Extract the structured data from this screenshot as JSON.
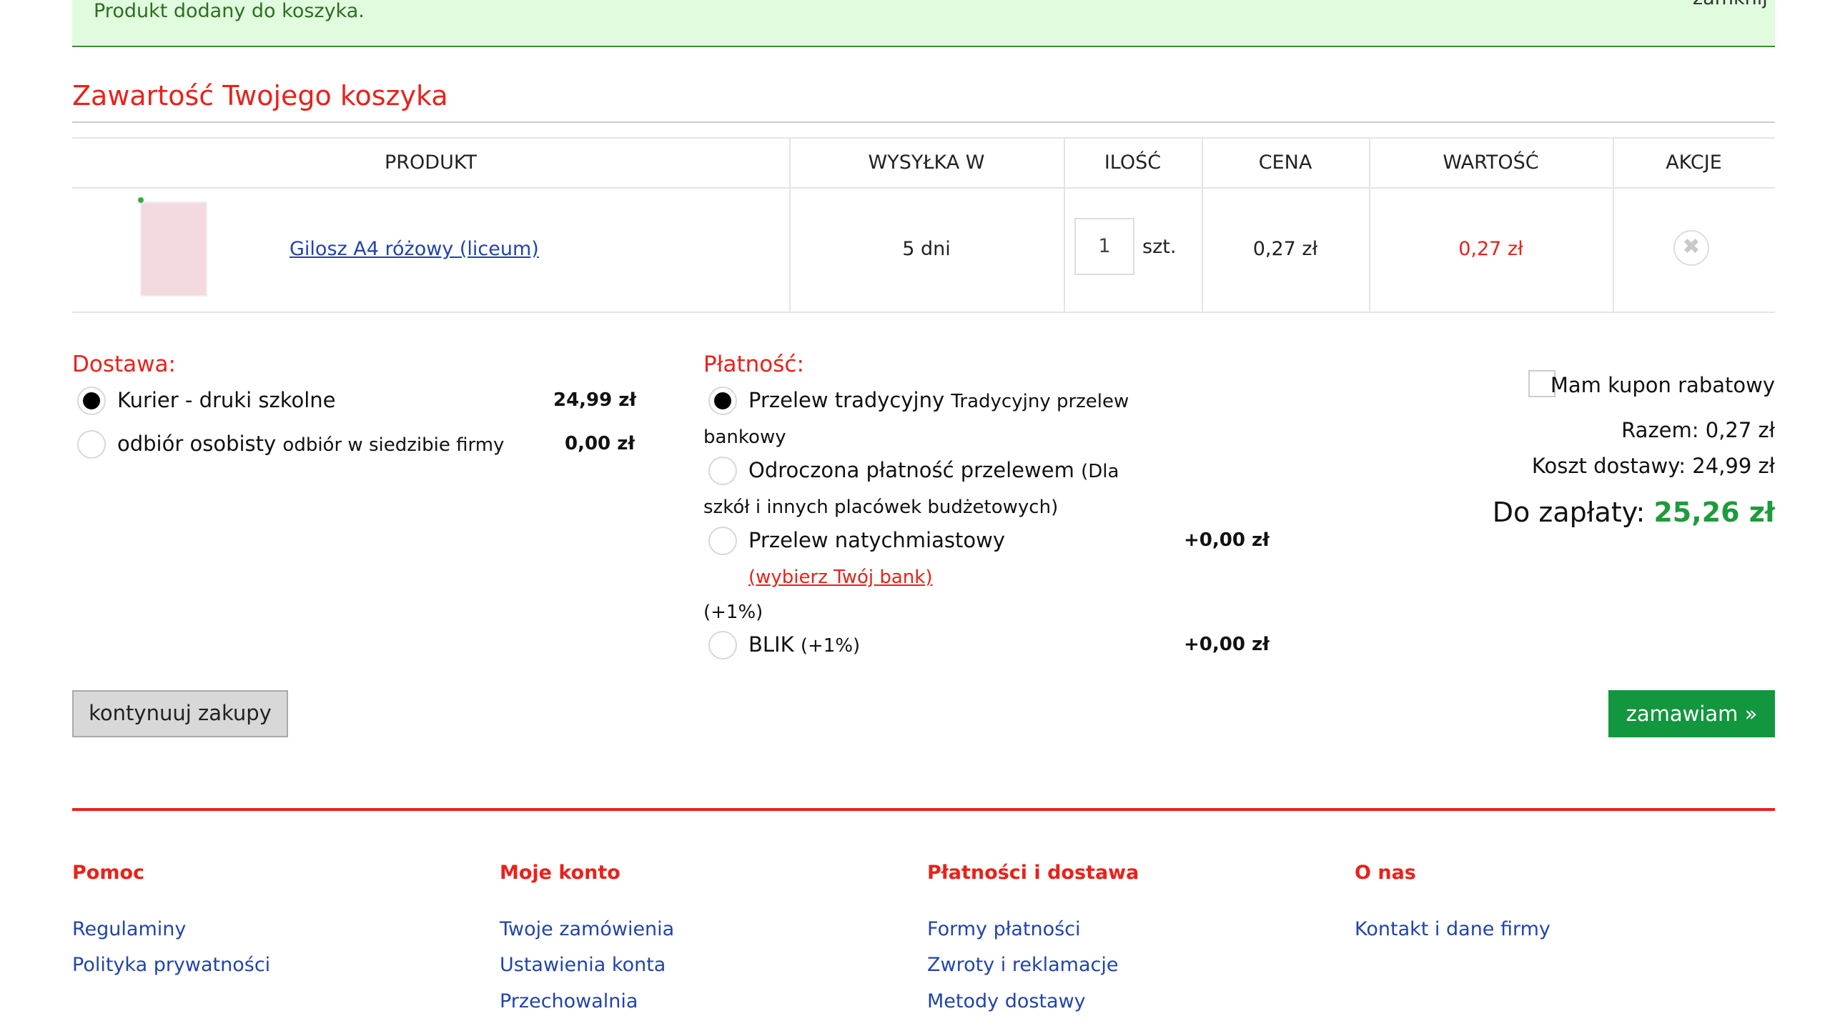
{
  "notice": {
    "text": "Produkt dodany do koszyka.",
    "close": "zamknij"
  },
  "cart": {
    "title": "Zawartość Twojego koszyka",
    "columns": [
      "PRODUKT",
      "WYSYŁKA W",
      "ILOŚĆ",
      "CENA",
      "WARTOŚĆ",
      "AKCJE"
    ],
    "items": [
      {
        "name": "Gilosz A4 różowy (liceum)",
        "shipping": "5 dni",
        "qty": "1",
        "unit": "szt.",
        "price": "0,27 zł",
        "value": "0,27 zł"
      }
    ]
  },
  "delivery": {
    "title": "Dostawa:",
    "options": [
      {
        "label": "Kurier - druki szkolne",
        "sub": "",
        "price": "24,99 zł",
        "selected": true
      },
      {
        "label": "odbiór osobisty",
        "sub": "odbiór w siedzibie firmy",
        "price": "0,00 zł",
        "selected": false
      }
    ]
  },
  "payment": {
    "title": "Płatność:",
    "opt1_label": "Przelew tradycyjny",
    "opt1_sub_a": "Tradycyjny przelew",
    "opt1_sub_b": "bankowy",
    "opt2_label": "Odroczona płatność przelewem",
    "opt2_sub_a": "(Dla",
    "opt2_sub_b": "szkół i innych placówek budżetowych)",
    "opt3_label": "Przelew natychmiastowy",
    "opt3_price": "+0,00 zł",
    "opt3_link": "(wybierz Twój bank)",
    "opt3_fee": "(+1%)",
    "opt4_label": "BLIK",
    "opt4_sub": "(+1%)",
    "opt4_price": "+0,00 zł"
  },
  "summary": {
    "coupon_label": "Mam kupon rabatowy",
    "subtotal": "Razem: 0,27 zł",
    "shipping": "Koszt dostawy: 24,99 zł",
    "total_label": "Do zapłaty:",
    "total_value": "25,26 zł"
  },
  "actions": {
    "continue": "kontynuuj zakupy",
    "order": "zamawiam »"
  },
  "footer": {
    "columns": [
      {
        "title": "Pomoc",
        "links": [
          "Regulaminy",
          "Polityka prywatności"
        ]
      },
      {
        "title": "Moje konto",
        "links": [
          "Twoje zamówienia",
          "Ustawienia konta",
          "Przechowalnia"
        ]
      },
      {
        "title": "Płatności i dostawa",
        "links": [
          "Formy płatności",
          "Zwroty i reklamacje",
          "Metody dostawy"
        ]
      },
      {
        "title": "O nas",
        "links": [
          "Kontakt i dane firmy"
        ]
      }
    ]
  },
  "colors": {
    "accent_red": "#e8221b",
    "success_green": "#12963e",
    "link_blue": "#2145a8",
    "notice_bg": "#e1fbde"
  }
}
